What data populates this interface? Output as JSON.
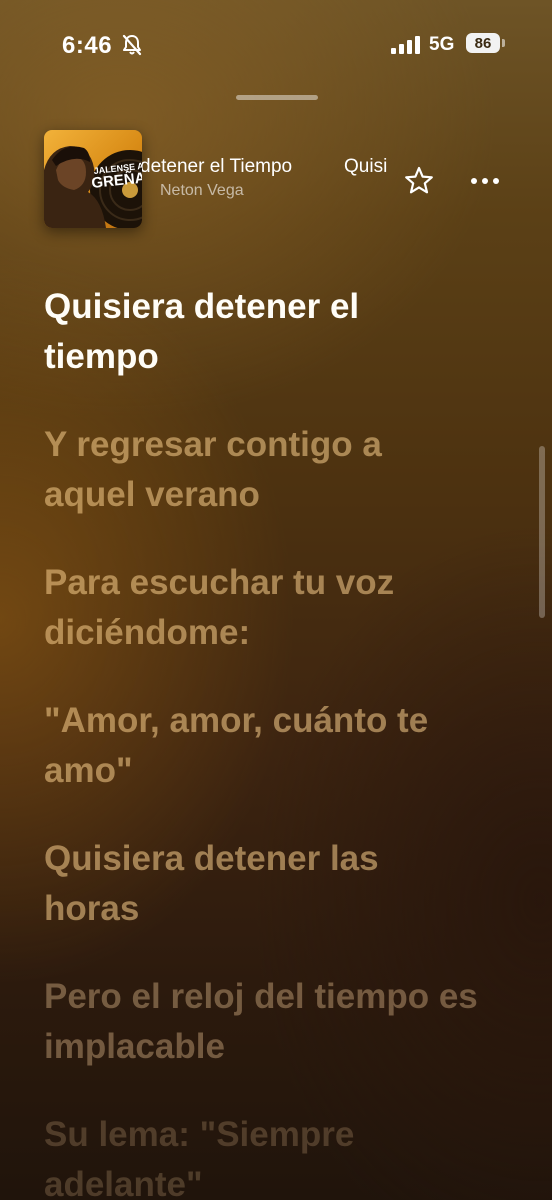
{
  "status_bar": {
    "time": "6:46",
    "network": "5G",
    "battery": "86"
  },
  "now_playing": {
    "title_visible": "detener el Tiempo",
    "title_next": "Quisi",
    "artist": "Neton Vega",
    "artwork_text": "JALENSE A LA GREÑA",
    "icons": {
      "favorite": "star-icon",
      "more": "ellipsis-icon",
      "silent": "bell-slash-icon"
    }
  },
  "lyrics": {
    "lines": [
      {
        "text": "Quisiera detener el tiempo"
      },
      {
        "text": "Y regresar contigo a aquel verano"
      },
      {
        "text": "Para escuchar tu voz diciéndome:"
      },
      {
        "text": "\"Amor, amor, cuánto te amo\""
      },
      {
        "text": "Quisiera detener las horas"
      },
      {
        "text": "Pero el reloj del tiempo es implacable"
      },
      {
        "text": "Su lema: \"Siempre adelante\""
      }
    ]
  },
  "colors": {
    "active_lyric": "#fffdf7",
    "inactive_lyric": "#f8ce8c"
  }
}
